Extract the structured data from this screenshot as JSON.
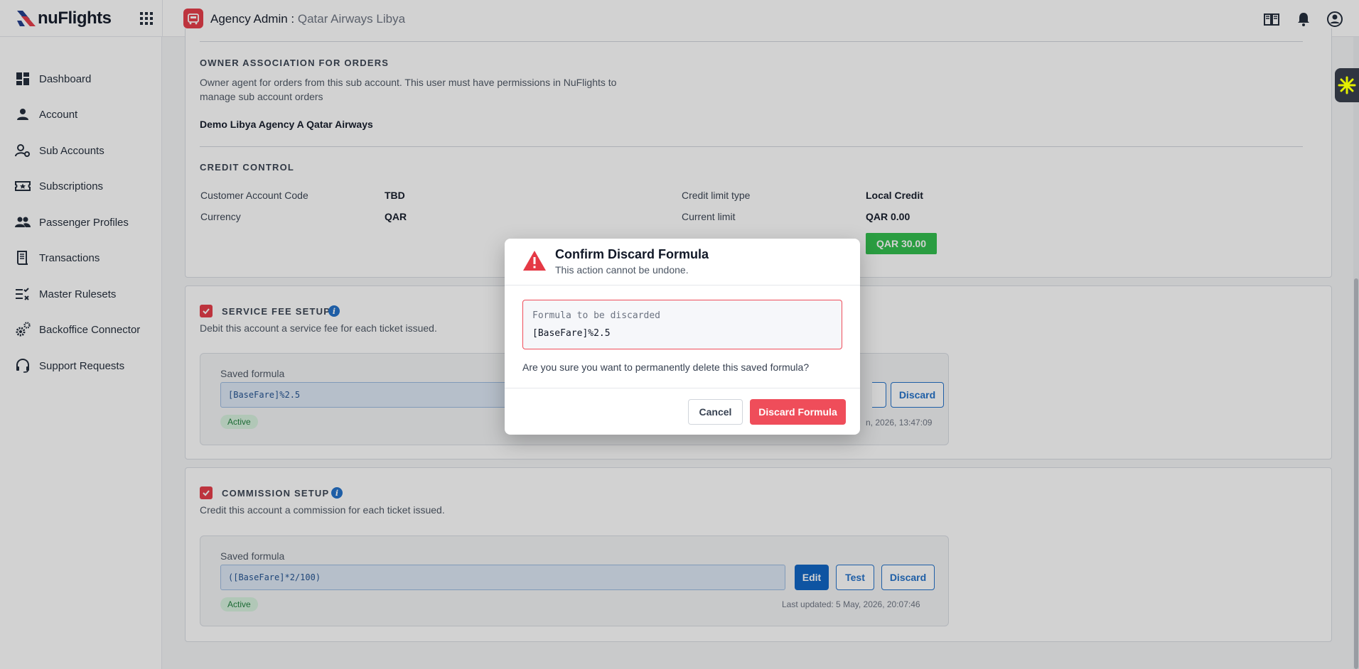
{
  "header": {
    "brand": "nuFlights",
    "title": "Agency Admin :",
    "subtitle": "Qatar Airways Libya"
  },
  "sidebar": {
    "items": [
      {
        "label": "Dashboard",
        "icon": "dashboard-icon"
      },
      {
        "label": "Account",
        "icon": "person-icon"
      },
      {
        "label": "Sub Accounts",
        "icon": "user-gear-icon"
      },
      {
        "label": "Subscriptions",
        "icon": "ticket-star-icon"
      },
      {
        "label": "Passenger Profiles",
        "icon": "people-icon"
      },
      {
        "label": "Transactions",
        "icon": "receipt-icon"
      },
      {
        "label": "Master Rulesets",
        "icon": "rules-icon"
      },
      {
        "label": "Backoffice Connector",
        "icon": "gears-icon"
      },
      {
        "label": "Support Requests",
        "icon": "headset-icon"
      }
    ]
  },
  "owner": {
    "title": "OWNER ASSOCIATION FOR ORDERS",
    "description_line1": "Owner agent for orders from this sub account. This user must have permissions in NuFlights to",
    "description_line2": "manage sub account orders",
    "agent": "Demo Libya Agency A Qatar Airways"
  },
  "credit": {
    "title": "CREDIT CONTROL",
    "customer_code_label": "Customer Account Code",
    "customer_code_value": "TBD",
    "currency_label": "Currency",
    "currency_value": "QAR",
    "limit_type_label": "Credit limit type",
    "limit_type_value": "Local Credit",
    "current_limit_label": "Current limit",
    "current_limit_value": "QAR 0.00",
    "balance_value": "QAR 30.00"
  },
  "service_fee": {
    "title": "SERVICE FEE SETUP",
    "description": "Debit this account a service fee for each ticket issued.",
    "saved_label": "Saved formula",
    "formula": "[BaseFare]%2.5",
    "status": "Active",
    "discard_label": "Discard",
    "updated_partial": "n, 2026, 13:47:09"
  },
  "commission": {
    "title": "COMMISSION SETUP",
    "description": "Credit this account a commission for each ticket issued.",
    "saved_label": "Saved formula",
    "formula": "([BaseFare]*2/100)",
    "status": "Active",
    "edit_label": "Edit",
    "test_label": "Test",
    "discard_label": "Discard",
    "updated": "Last updated: 5 May, 2026, 20:07:46"
  },
  "modal": {
    "title": "Confirm Discard Formula",
    "subtitle": "This action cannot be undone.",
    "formula_label": "Formula to be discarded",
    "formula_value": "[BaseFare]%2.5",
    "question": "Are you sure you want to permanently delete this saved formula?",
    "cancel_label": "Cancel",
    "confirm_label": "Discard Formula"
  },
  "colors": {
    "accent": "#0b62c4",
    "danger": "#ef4d5a",
    "success": "#2ebd4a"
  }
}
